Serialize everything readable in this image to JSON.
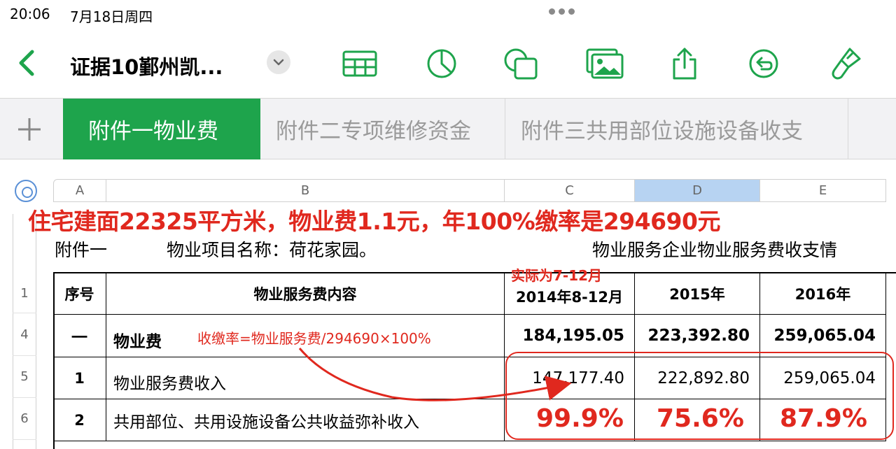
{
  "status_bar": {
    "time": "20:06",
    "date": "7月18日周四"
  },
  "toolbar": {
    "title": "证据10鄞州凯...",
    "icons": [
      "back-chevron-icon",
      "chevron-down-icon",
      "table-icon",
      "chart-icon",
      "shapes-icon",
      "media-icon",
      "share-icon",
      "undo-icon",
      "format-brush-icon"
    ]
  },
  "sheet_tabs": {
    "add_label": "+",
    "tabs": [
      "附件一物业费",
      "附件二专项维修资金",
      "附件三共用部位设施设备收支"
    ],
    "active_index": 0
  },
  "columns": [
    "A",
    "B",
    "C",
    "D",
    "E"
  ],
  "selected_column": "D",
  "rows": [
    "1",
    "4",
    "5",
    "6"
  ],
  "annotations": {
    "top": "住宅建面22325平方米，物业费1.1元，年100%缴率是294690元",
    "c_header_note": "实际为7-12月",
    "formula": "收缴率=物业服务费/294690×100%",
    "rates": [
      "99.9%",
      "75.6%",
      "87.9%"
    ],
    "accent_color": "#e0281e"
  },
  "caption": {
    "left": "附件一",
    "project": "物业项目名称：荷花家园。",
    "right": "物业服务企业物业服务费收支情"
  },
  "table": {
    "headers": [
      "序号",
      "物业服务费内容",
      "2014年8-12月",
      "2015年",
      "2016年"
    ],
    "rows": [
      [
        "一",
        "物业费",
        "184,195.05",
        "223,392.80",
        "259,065.04"
      ],
      [
        "1",
        "物业服务费收入",
        "147,177.40",
        "222,892.80",
        "259,065.04"
      ],
      [
        "2",
        "共用部位、共用设施设备公共收益弥补收入",
        "",
        "",
        ""
      ]
    ]
  },
  "colors": {
    "brand_green": "#1ea44c",
    "selection_blue": "#b7d3f2"
  }
}
